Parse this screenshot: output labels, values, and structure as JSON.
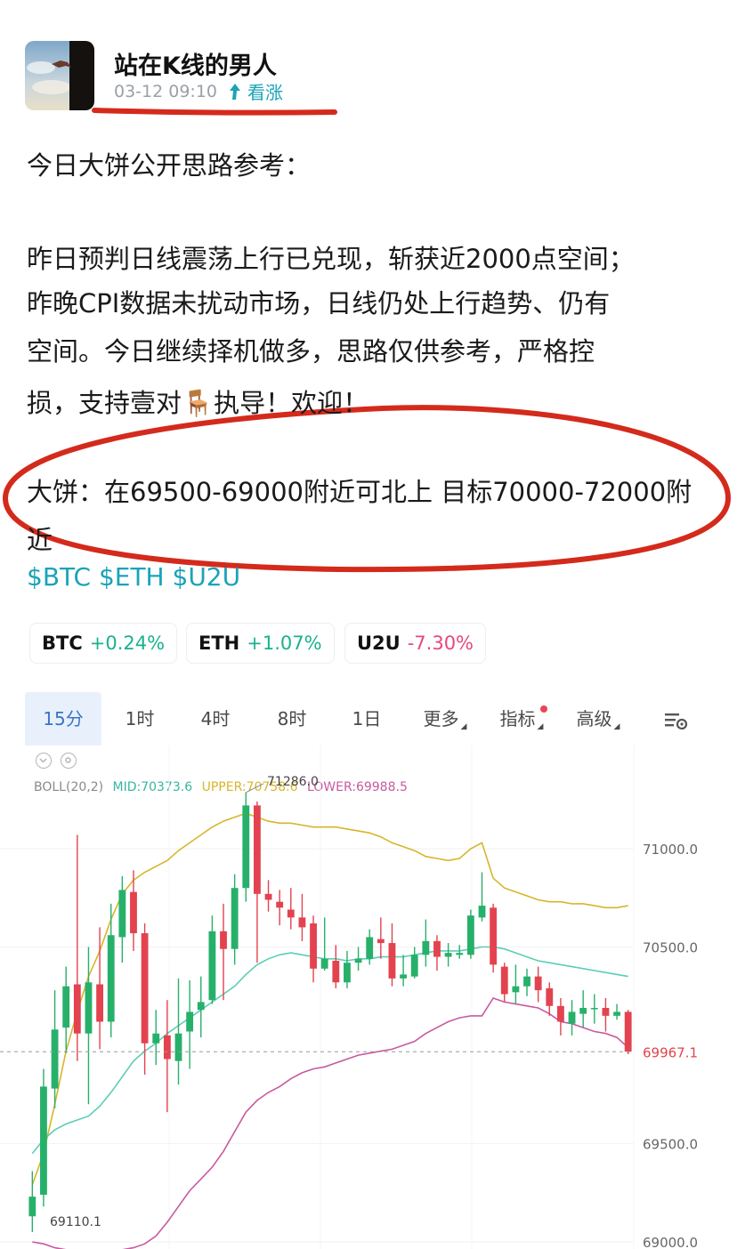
{
  "post": {
    "author": "站在K线的男人",
    "timestamp": "03-12 09:10",
    "sentiment": "看涨",
    "lines": [
      "今日大饼公开思路参考：",
      "昨日预判日线震荡上行已兑现，斩获近2000点空间；",
      "昨晚CPI数据未扰动市场，日线仍处上行趋势、仍有",
      "空间。今日继续择机做多，思路仅供参考，严格控",
      "损，支持壹对🪑执导！欢迎！",
      "大饼：在69500-69000附近可北上 目标70000-72000附",
      "近"
    ],
    "hashtags": "$BTC $ETH $U2U"
  },
  "coins": [
    {
      "symbol": "BTC",
      "change": "+0.24%",
      "direction": "up"
    },
    {
      "symbol": "ETH",
      "change": "+1.07%",
      "direction": "up"
    },
    {
      "symbol": "U2U",
      "change": "-7.30%",
      "direction": "down"
    }
  ],
  "chart_tabs": {
    "items": [
      "15分",
      "1时",
      "4时",
      "8时",
      "1日",
      "更多",
      "指标",
      "高级"
    ],
    "active": "15分"
  },
  "indicator": {
    "name": "BOLL(20,2)",
    "mid": "MID:70373.6",
    "upper": "UPPER:70758.6",
    "lower": "LOWER:69988.5"
  },
  "colors": {
    "accent": "#1aa3b8",
    "up": "#19b28e",
    "down": "#e8487a",
    "candle_up": "#27b06a",
    "candle_down": "#e2434f",
    "boll_mid": "#5ccdb6",
    "boll_upper": "#d8b52a",
    "boll_lower": "#c85aa0",
    "annotation": "#d42a1c"
  },
  "chart_data": {
    "type": "candlestick",
    "interval": "15分",
    "y_ticks": [
      "71000.0",
      "70500.0",
      "69500.0",
      "69000.0"
    ],
    "y_tick_values": [
      71000,
      70500,
      69500,
      69000
    ],
    "ylim": [
      68970,
      71400
    ],
    "last_price_label": "69967.1",
    "last_price": 69967.1,
    "high_label": "71286.0",
    "high": 71286,
    "low_label": "69110.1",
    "low": 69110.1,
    "candles": [
      {
        "o": 69130,
        "c": 69230,
        "h": 69360,
        "l": 69050
      },
      {
        "o": 69240,
        "c": 69790,
        "h": 69880,
        "l": 69180
      },
      {
        "o": 69780,
        "c": 70080,
        "h": 70280,
        "l": 69680
      },
      {
        "o": 70090,
        "c": 70300,
        "h": 70400,
        "l": 69960
      },
      {
        "o": 70310,
        "c": 70060,
        "h": 71070,
        "l": 69920
      },
      {
        "o": 70060,
        "c": 70320,
        "h": 70500,
        "l": 69700
      },
      {
        "o": 70310,
        "c": 70120,
        "h": 70600,
        "l": 69980
      },
      {
        "o": 70120,
        "c": 70560,
        "h": 70720,
        "l": 70040
      },
      {
        "o": 70550,
        "c": 70790,
        "h": 70860,
        "l": 70420
      },
      {
        "o": 70780,
        "c": 70570,
        "h": 70890,
        "l": 70480
      },
      {
        "o": 70570,
        "c": 70010,
        "h": 70620,
        "l": 69850
      },
      {
        "o": 70010,
        "c": 70060,
        "h": 70180,
        "l": 69900
      },
      {
        "o": 70050,
        "c": 69930,
        "h": 70230,
        "l": 69660
      },
      {
        "o": 69920,
        "c": 70060,
        "h": 70340,
        "l": 69800
      },
      {
        "o": 70070,
        "c": 70170,
        "h": 70330,
        "l": 69880
      },
      {
        "o": 70180,
        "c": 70220,
        "h": 70350,
        "l": 70040
      },
      {
        "o": 70230,
        "c": 70580,
        "h": 70660,
        "l": 70210
      },
      {
        "o": 70580,
        "c": 70490,
        "h": 70720,
        "l": 70230
      },
      {
        "o": 70490,
        "c": 70800,
        "h": 70870,
        "l": 70410
      },
      {
        "o": 70800,
        "c": 71220,
        "h": 71286,
        "l": 70730
      },
      {
        "o": 71220,
        "c": 70770,
        "h": 71240,
        "l": 70420
      },
      {
        "o": 70770,
        "c": 70740,
        "h": 70840,
        "l": 70680
      },
      {
        "o": 70730,
        "c": 70700,
        "h": 70790,
        "l": 70610
      },
      {
        "o": 70690,
        "c": 70650,
        "h": 70800,
        "l": 70590
      },
      {
        "o": 70650,
        "c": 70600,
        "h": 70770,
        "l": 70530
      },
      {
        "o": 70620,
        "c": 70390,
        "h": 70660,
        "l": 70320
      },
      {
        "o": 70390,
        "c": 70440,
        "h": 70650,
        "l": 70380
      },
      {
        "o": 70430,
        "c": 70320,
        "h": 70510,
        "l": 70290
      },
      {
        "o": 70320,
        "c": 70420,
        "h": 70480,
        "l": 70290
      },
      {
        "o": 70420,
        "c": 70440,
        "h": 70500,
        "l": 70380
      },
      {
        "o": 70440,
        "c": 70550,
        "h": 70590,
        "l": 70410
      },
      {
        "o": 70540,
        "c": 70520,
        "h": 70650,
        "l": 70440
      },
      {
        "o": 70520,
        "c": 70340,
        "h": 70620,
        "l": 70300
      },
      {
        "o": 70340,
        "c": 70360,
        "h": 70460,
        "l": 70300
      },
      {
        "o": 70350,
        "c": 70460,
        "h": 70500,
        "l": 70340
      },
      {
        "o": 70460,
        "c": 70530,
        "h": 70640,
        "l": 70400
      },
      {
        "o": 70530,
        "c": 70450,
        "h": 70560,
        "l": 70380
      },
      {
        "o": 70450,
        "c": 70470,
        "h": 70520,
        "l": 70400
      },
      {
        "o": 70460,
        "c": 70470,
        "h": 70510,
        "l": 70440
      },
      {
        "o": 70460,
        "c": 70660,
        "h": 70690,
        "l": 70440
      },
      {
        "o": 70650,
        "c": 70710,
        "h": 70880,
        "l": 70630
      },
      {
        "o": 70700,
        "c": 70410,
        "h": 70720,
        "l": 70370
      },
      {
        "o": 70400,
        "c": 70260,
        "h": 70420,
        "l": 70220
      },
      {
        "o": 70270,
        "c": 70300,
        "h": 70410,
        "l": 70210
      },
      {
        "o": 70300,
        "c": 70350,
        "h": 70390,
        "l": 70250
      },
      {
        "o": 70350,
        "c": 70280,
        "h": 70400,
        "l": 70220
      },
      {
        "o": 70290,
        "c": 70200,
        "h": 70320,
        "l": 70150
      },
      {
        "o": 70200,
        "c": 70120,
        "h": 70240,
        "l": 70050
      },
      {
        "o": 70110,
        "c": 70170,
        "h": 70230,
        "l": 70050
      },
      {
        "o": 70160,
        "c": 70190,
        "h": 70280,
        "l": 70090
      },
      {
        "o": 70190,
        "c": 70190,
        "h": 70260,
        "l": 70110
      },
      {
        "o": 70190,
        "c": 70150,
        "h": 70240,
        "l": 70070
      },
      {
        "o": 70150,
        "c": 70170,
        "h": 70210,
        "l": 70130
      },
      {
        "o": 70170,
        "c": 69968,
        "h": 70180,
        "l": 69955
      }
    ],
    "boll_mid": [
      69450,
      69520,
      69570,
      69600,
      69620,
      69640,
      69690,
      69760,
      69840,
      69920,
      69970,
      70010,
      70060,
      70100,
      70140,
      70180,
      70220,
      70260,
      70300,
      70360,
      70410,
      70440,
      70460,
      70470,
      70460,
      70450,
      70440,
      70440,
      70430,
      70440,
      70440,
      70450,
      70450,
      70450,
      70460,
      70470,
      70480,
      70480,
      70480,
      70490,
      70500,
      70500,
      70490,
      70470,
      70450,
      70430,
      70420,
      70410,
      70400,
      70390,
      70380,
      70370,
      70360,
      70350
    ],
    "boll_upper": [
      69290,
      69450,
      69700,
      69970,
      70170,
      70350,
      70480,
      70640,
      70770,
      70840,
      70880,
      70910,
      70940,
      70990,
      71030,
      71070,
      71110,
      71140,
      71160,
      71180,
      71160,
      71140,
      71130,
      71130,
      71120,
      71110,
      71110,
      71110,
      71100,
      71090,
      71080,
      71060,
      71030,
      71010,
      70990,
      70960,
      70950,
      70940,
      70950,
      71000,
      71030,
      70850,
      70800,
      70780,
      70760,
      70740,
      70730,
      70730,
      70720,
      70720,
      70710,
      70700,
      70700,
      70710
    ],
    "boll_lower": [
      69000,
      68990,
      68970,
      68960,
      68960,
      68960,
      68960,
      68960,
      68960,
      68970,
      68990,
      69030,
      69100,
      69180,
      69260,
      69320,
      69380,
      69460,
      69560,
      69660,
      69720,
      69760,
      69790,
      69830,
      69860,
      69880,
      69890,
      69910,
      69930,
      69950,
      69960,
      69970,
      69980,
      70000,
      70020,
      70060,
      70090,
      70120,
      70140,
      70150,
      70150,
      70240,
      70220,
      70210,
      70200,
      70190,
      70160,
      70120,
      70110,
      70090,
      70070,
      70060,
      70040,
      69988
    ]
  }
}
